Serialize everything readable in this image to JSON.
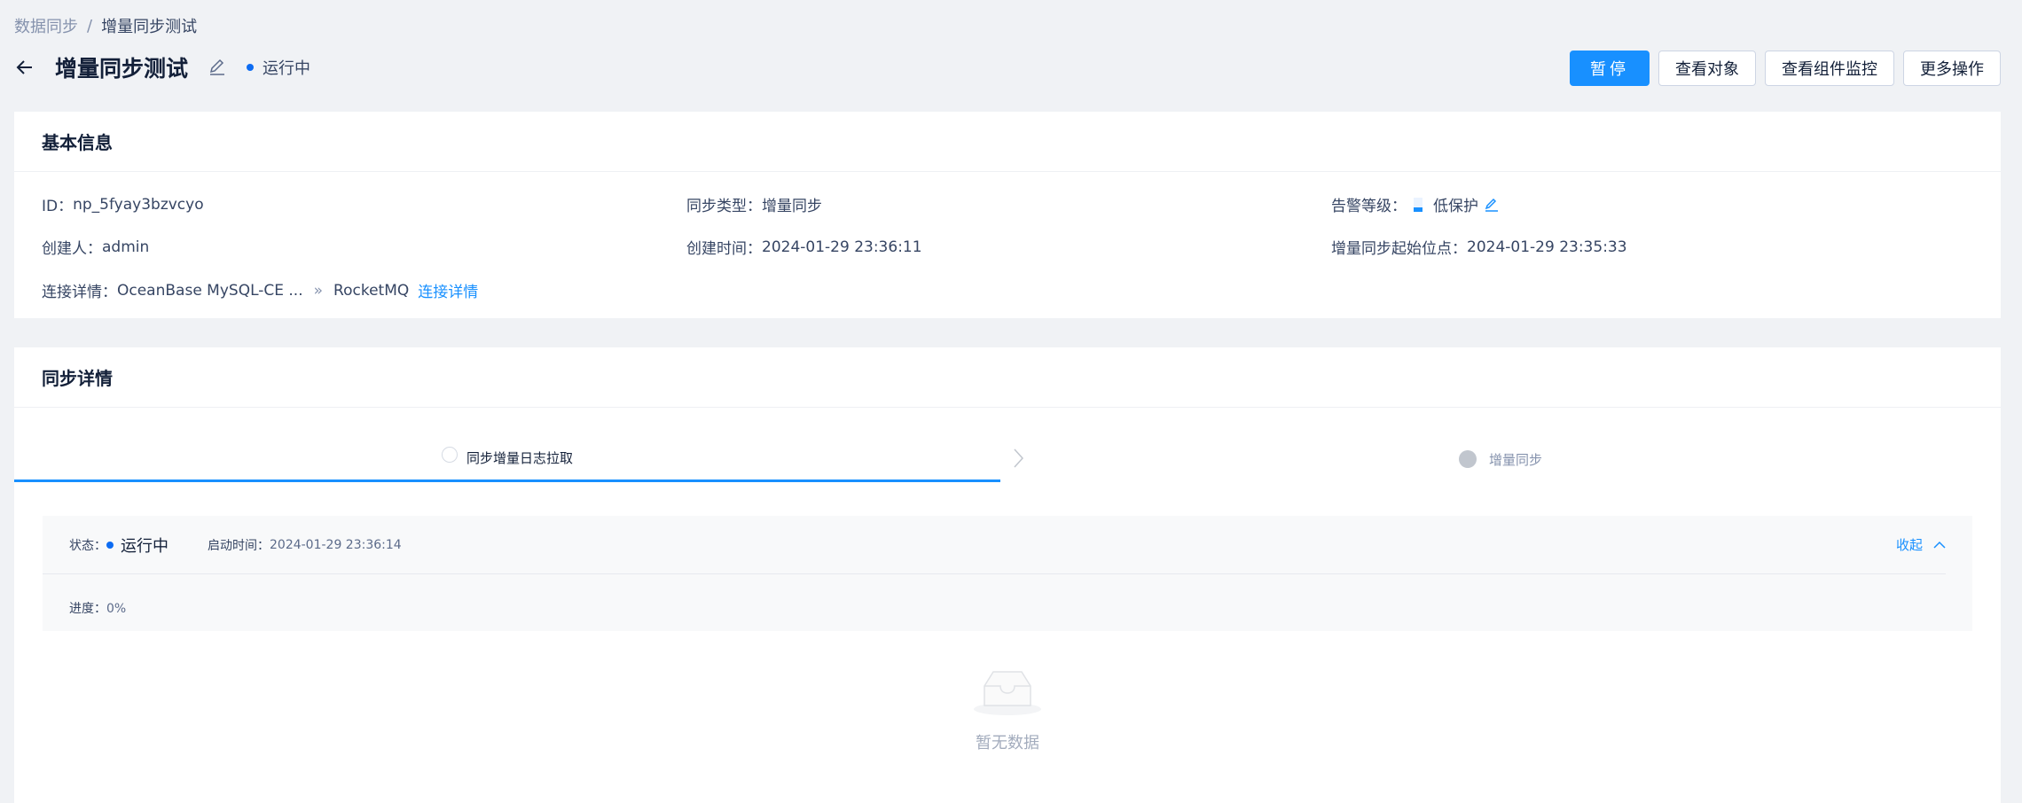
{
  "breadcrumb": {
    "root": "数据同步",
    "separator": "/",
    "current": "增量同步测试"
  },
  "header": {
    "title": "增量同步测试",
    "status": "运行中"
  },
  "actions": {
    "pause": "暂停",
    "view_objects": "查看对象",
    "view_monitor": "查看组件监控",
    "more": "更多操作"
  },
  "basic_info": {
    "title": "基本信息",
    "id_label": "ID：",
    "id_value": "np_5fyay3bzvcyo",
    "sync_type_label": "同步类型：",
    "sync_type_value": "增量同步",
    "alert_label": "告警等级：",
    "alert_value": "低保护",
    "creator_label": "创建人：",
    "creator_value": "admin",
    "created_label": "创建时间：",
    "created_value": "2024-01-29 23:36:11",
    "start_point_label": "增量同步起始位点：",
    "start_point_value": "2024-01-29 23:35:33",
    "conn_label": "连接详情：",
    "conn_source": "OceanBase MySQL-CE ...",
    "conn_arrow": "»",
    "conn_target": "RocketMQ",
    "conn_link": "连接详情"
  },
  "sync_details": {
    "title": "同步详情",
    "tabs": [
      {
        "label": "同步增量日志拉取"
      },
      {
        "label": "增量同步"
      }
    ],
    "status_label": "状态：",
    "status_value": "运行中",
    "start_time_label": "启动时间：",
    "start_time_value": "2024-01-29 23:36:14",
    "collapse": "收起",
    "progress_label": "进度：",
    "progress_value": "0%",
    "empty_text": "暂无数据"
  },
  "colors": {
    "primary": "#1890ff",
    "running_dot": "#0d6cf2",
    "page_bg": "#f0f2f5"
  }
}
